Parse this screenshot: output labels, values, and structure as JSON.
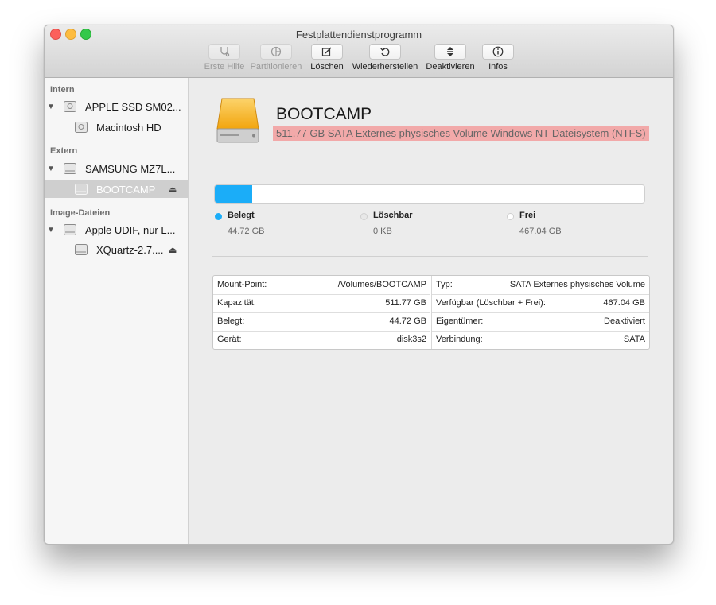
{
  "window": {
    "title": "Festplattendienstprogramm"
  },
  "toolbar": {
    "items": [
      {
        "label": "Erste Hilfe",
        "icon": "stethoscope-icon",
        "enabled": false
      },
      {
        "label": "Partitionieren",
        "icon": "partition-pie-icon",
        "enabled": false
      },
      {
        "label": "Löschen",
        "icon": "erase-icon",
        "enabled": true
      },
      {
        "label": "Wiederherstellen",
        "icon": "restore-arrow-icon",
        "enabled": true
      },
      {
        "label": "Deaktivieren",
        "icon": "unmount-icon",
        "enabled": true
      },
      {
        "label": "Infos",
        "icon": "info-icon",
        "enabled": true
      }
    ]
  },
  "sidebar": {
    "sections": [
      {
        "header": "Intern"
      },
      {
        "header": "Extern"
      },
      {
        "header": "Image-Dateien"
      }
    ],
    "items": [
      {
        "label": "APPLE SSD SM02...",
        "level": 0,
        "selected": false
      },
      {
        "label": "Macintosh HD",
        "level": 1,
        "selected": false
      },
      {
        "label": "SAMSUNG MZ7L...",
        "level": 0,
        "selected": false
      },
      {
        "label": "BOOTCAMP",
        "level": 1,
        "selected": true,
        "eject": "⏏"
      },
      {
        "label": "Apple UDIF, nur L...",
        "level": 0,
        "selected": false
      },
      {
        "label": "XQuartz-2.7....",
        "level": 1,
        "selected": false,
        "eject": "⏏"
      }
    ]
  },
  "volume": {
    "name": "BOOTCAMP",
    "description": "511.77 GB SATA Externes physisches Volume Windows NT-Dateisystem (NTFS)",
    "highlight_color": "#f2a9a9"
  },
  "usage": {
    "used_fraction": 0.0874,
    "fill_color": "#1badf8",
    "legend": [
      {
        "name": "Belegt",
        "value": "44.72 GB",
        "color": "#1badf8"
      },
      {
        "name": "Löschbar",
        "value": "0 KB",
        "color": "#e8e8e8"
      },
      {
        "name": "Frei",
        "value": "467.04 GB",
        "color": "#ffffff"
      }
    ]
  },
  "info": {
    "left": [
      {
        "key": "Mount-Point:",
        "value": "/Volumes/BOOTCAMP"
      },
      {
        "key": "Kapazität:",
        "value": "511.77 GB"
      },
      {
        "key": "Belegt:",
        "value": "44.72 GB"
      },
      {
        "key": "Gerät:",
        "value": "disk3s2"
      }
    ],
    "right": [
      {
        "key": "Typ:",
        "value": "SATA Externes physisches Volume"
      },
      {
        "key": "Verfügbar (Löschbar + Frei):",
        "value": "467.04 GB"
      },
      {
        "key": "Eigentümer:",
        "value": "Deaktiviert"
      },
      {
        "key": "Verbindung:",
        "value": "SATA"
      }
    ]
  }
}
